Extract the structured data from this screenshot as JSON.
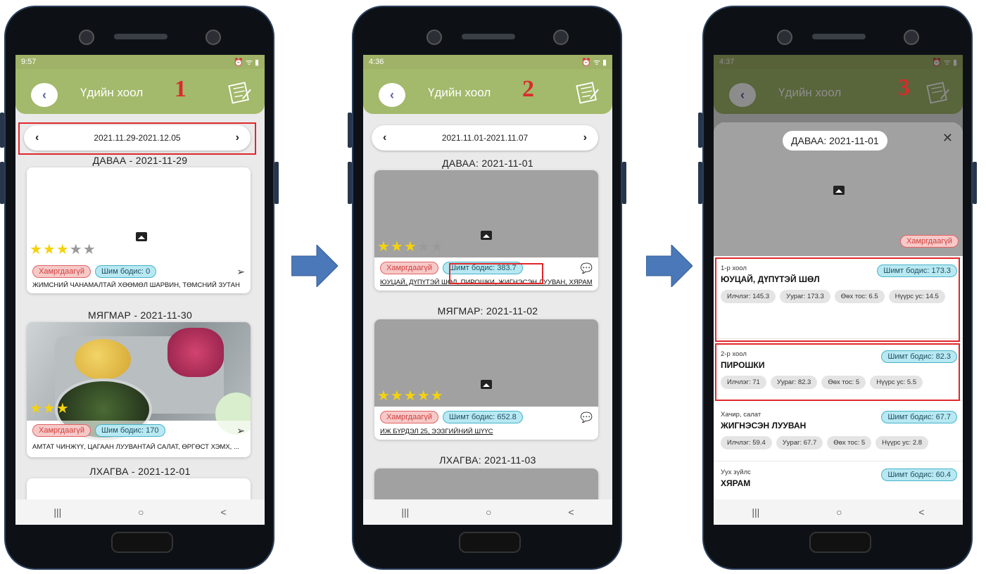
{
  "phone1": {
    "status_time": "9:57",
    "title": "Үдийн хоол",
    "step": "1",
    "week_range": "2021.11.29-2021.12.05",
    "days": [
      {
        "header": "ДАВАА - 2021-11-29",
        "badge_red": "Хамргдаагүй",
        "badge_blue": "Шим бодис: 0",
        "caption": "ЖИМСНИЙ ЧАНАМАЛТАЙ ХӨӨМӨЛ ШАРВИН, ТӨМСНИЙ ЗУТАН"
      },
      {
        "header": "МЯГМАР - 2021-11-30",
        "badge_red": "Хамргдаагүй",
        "badge_blue": "Шим бодис: 170",
        "caption": "АМТАТ ЧИНЖҮҮ, ЦАГААН ЛУУВАНТАЙ САЛАТ, ӨРГӨСТ ХЭМХ, ..."
      },
      {
        "header": "ЛХАГВА - 2021-12-01"
      }
    ]
  },
  "phone2": {
    "status_time": "4:36",
    "title": "Үдийн хоол",
    "step": "2",
    "week_range": "2021.11.01-2021.11.07",
    "days": [
      {
        "header": "ДАВАА: 2021-11-01",
        "badge_red": "Хамргдаагүй",
        "badge_blue": "Шимт бодис: 383.7",
        "caption": "ЮУЦАЙ, ДҮПҮТЭЙ ШӨЛ, ПИРОШКИ, ЖИГНЭСЭН ЛУУВАН, ХЯРАМ"
      },
      {
        "header": "МЯГМАР: 2021-11-02",
        "badge_red": "Хамргдаагүй",
        "badge_blue": "Шимт бодис: 652.8",
        "caption": "ИЖ БҮРДЭЛ 25, ЭЭЗГИЙНИЙ ШҮҮС"
      },
      {
        "header": "ЛХАГВА: 2021-11-03"
      }
    ]
  },
  "phone3": {
    "status_time": "4:37",
    "title": "Үдийн хоол",
    "step": "3",
    "sheet_title": "ДАВАА: 2021-11-01",
    "badge_red": "Хамргдаагүй",
    "items": [
      {
        "category": "1-р хоол",
        "name": "ЮУЦАЙ, ДҮПҮТЭЙ ШӨЛ",
        "badge": "Шимт бодис: 173.3",
        "nutrients": [
          "Илчлэг: 145.3",
          "Уураг: 173.3",
          "Өөх тос: 6.5",
          "Нүүрс ус: 14.5"
        ]
      },
      {
        "category": "2-р хоол",
        "name": "ПИРОШКИ",
        "badge": "Шимт бодис: 82.3",
        "nutrients": [
          "Илчлэг: 71",
          "Уураг: 82.3",
          "Өөх тос: 5",
          "Нүүрс ус: 5.5"
        ]
      },
      {
        "category": "Хачир, салат",
        "name": "ЖИГНЭСЭН ЛУУВАН",
        "badge": "Шимт бодис: 67.7",
        "nutrients": [
          "Илчлэг: 59.4",
          "Уураг: 67.7",
          "Өөх тос: 5",
          "Нүүрс ус: 2.8"
        ]
      },
      {
        "category": "Уух зүйлс",
        "name": "ХЯРАМ",
        "badge": "Шимт бодис: 60.4"
      }
    ]
  },
  "nav": {
    "recent": "|||",
    "home": "○",
    "back": "<"
  },
  "colors": {
    "appbar": "#a3b96b",
    "highlight": "#e0272a",
    "chip_red": "#f6c9c8",
    "chip_blue": "#b8e8f2",
    "arrow": "#4a78b8"
  }
}
